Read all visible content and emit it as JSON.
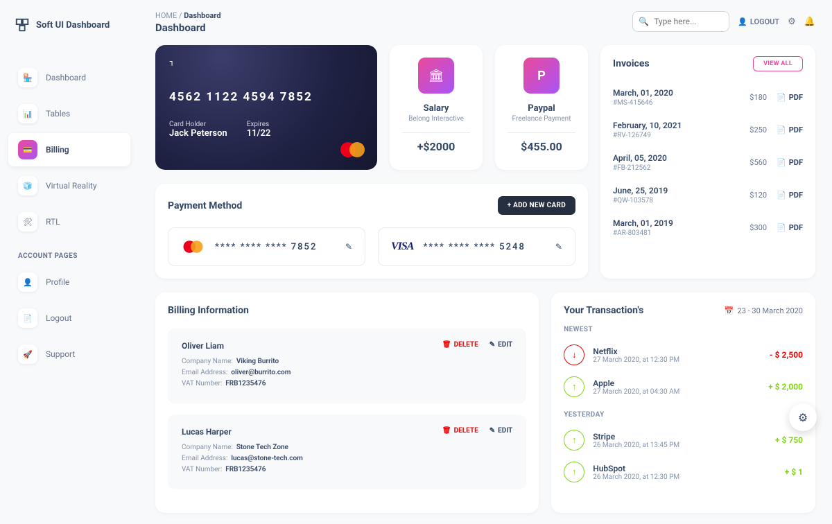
{
  "appName": "Soft UI Dashboard",
  "breadcrumb": {
    "root": "HOME",
    "current": "Dashboard"
  },
  "pageTitle": "Dashboard",
  "search": {
    "placeholder": "Type here..."
  },
  "logoutLabel": "LOGOUT",
  "nav": {
    "items": [
      {
        "label": "Dashboard",
        "icon": "🏪"
      },
      {
        "label": "Tables",
        "icon": "📊"
      },
      {
        "label": "Billing",
        "icon": "💳"
      },
      {
        "label": "Virtual Reality",
        "icon": "🧊"
      },
      {
        "label": "RTL",
        "icon": "🛠"
      }
    ],
    "sectionTitle": "ACCOUNT PAGES",
    "accountItems": [
      {
        "label": "Profile",
        "icon": "👤"
      },
      {
        "label": "Logout",
        "icon": "📄"
      },
      {
        "label": "Support",
        "icon": "🚀"
      }
    ]
  },
  "creditCard": {
    "number": "4562   1122   4594   7852",
    "holderLabel": "Card Holder",
    "holder": "Jack Peterson",
    "expiresLabel": "Expires",
    "expires": "11/22"
  },
  "miniCards": [
    {
      "title": "Salary",
      "sub": "Belong Interactive",
      "amount": "+$2000"
    },
    {
      "title": "Paypal",
      "sub": "Freelance Payment",
      "amount": "$455.00"
    }
  ],
  "invoices": {
    "title": "Invoices",
    "viewAllLabel": "VIEW ALL",
    "pdfLabel": "PDF",
    "items": [
      {
        "date": "March, 01, 2020",
        "id": "#MS-415646",
        "amount": "$180"
      },
      {
        "date": "February, 10, 2021",
        "id": "#RV-126749",
        "amount": "$250"
      },
      {
        "date": "April, 05, 2020",
        "id": "#FB-212562",
        "amount": "$560"
      },
      {
        "date": "June, 25, 2019",
        "id": "#QW-103578",
        "amount": "$120"
      },
      {
        "date": "March, 01, 2019",
        "id": "#AR-803481",
        "amount": "$300"
      }
    ]
  },
  "paymentMethod": {
    "title": "Payment Method",
    "addLabel": "+  ADD NEW CARD",
    "cards": [
      {
        "brand": "mastercard",
        "number": "****   ****   ****   7852"
      },
      {
        "brand": "visa",
        "number": "****   ****   ****   5248"
      }
    ]
  },
  "billingInfo": {
    "title": "Billing Information",
    "deleteLabel": "DELETE",
    "editLabel": "EDIT",
    "companyLabel": "Company Name:",
    "emailLabel": "Email Address:",
    "vatLabel": "VAT Number:",
    "items": [
      {
        "name": "Oliver Liam",
        "company": "Viking Burrito",
        "email": "oliver@burrito.com",
        "vat": "FRB1235476"
      },
      {
        "name": "Lucas Harper",
        "company": "Stone Tech Zone",
        "email": "lucas@stone-tech.com",
        "vat": "FRB1235476"
      }
    ]
  },
  "transactions": {
    "title": "Your Transaction's",
    "range": "23 - 30 March 2020",
    "sections": {
      "newest": "NEWEST",
      "yesterday": "YESTERDAY"
    },
    "newest": [
      {
        "name": "Netflix",
        "date": "27 March 2020, at 12:30 PM",
        "amount": "- $ 2,500",
        "dir": "down"
      },
      {
        "name": "Apple",
        "date": "27 March 2020, at 04:30 AM",
        "amount": "+ $ 2,000",
        "dir": "up"
      }
    ],
    "yesterday": [
      {
        "name": "Stripe",
        "date": "26 March 2020, at 13:45 PM",
        "amount": "+ $ 750",
        "dir": "up"
      },
      {
        "name": "HubSpot",
        "date": "26 March 2020, at 12:30 PM",
        "amount": "+ $ 1",
        "dir": "up"
      }
    ]
  }
}
